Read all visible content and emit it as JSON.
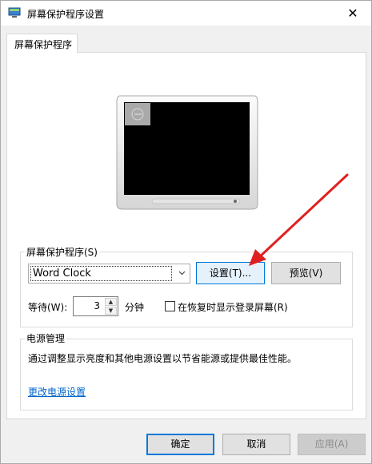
{
  "window": {
    "title": "屏幕保护程序设置",
    "close_glyph": "✕"
  },
  "tabs": [
    {
      "label": "屏幕保护程序"
    }
  ],
  "screensaver": {
    "group_label": "屏幕保护程序(S)",
    "selected": "Word Clock",
    "settings_button": "设置(T)...",
    "preview_button": "预览(V)",
    "wait_label": "等待(W):",
    "wait_value": "3",
    "wait_unit": "分钟",
    "resume_label": "在恢复时显示登录屏幕(R)",
    "resume_checked": false
  },
  "power": {
    "group_label": "电源管理",
    "description": "通过调整显示亮度和其他电源设置以节省能源或提供最佳性能。",
    "link": "更改电源设置"
  },
  "footer": {
    "ok": "确定",
    "cancel": "取消",
    "apply": "应用(A)"
  },
  "colors": {
    "accent": "#0078d7",
    "annotation_arrow": "#e02020",
    "link": "#0066cc"
  }
}
